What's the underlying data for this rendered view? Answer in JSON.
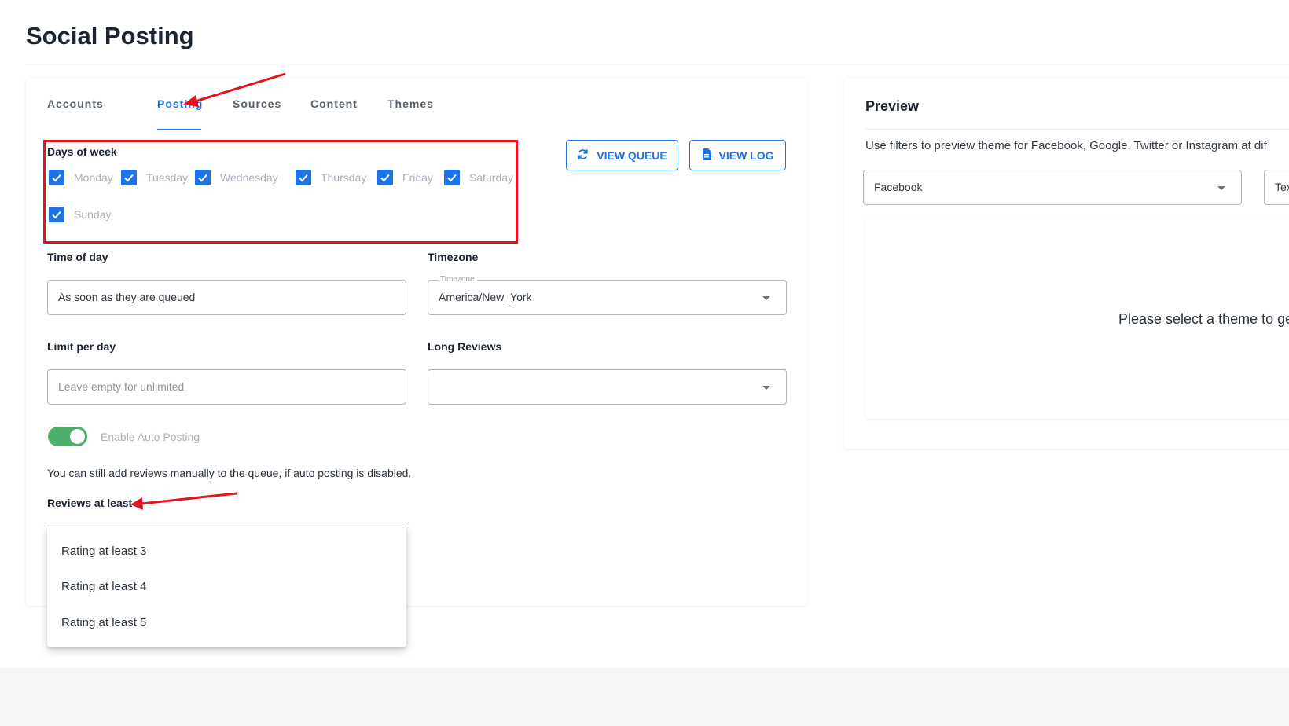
{
  "page": {
    "title": "Social Posting"
  },
  "tabs": [
    {
      "label": "Accounts",
      "active": false
    },
    {
      "label": "Posting",
      "active": true
    },
    {
      "label": "Sources",
      "active": false
    },
    {
      "label": "Content",
      "active": false
    },
    {
      "label": "Themes",
      "active": false
    }
  ],
  "posting": {
    "days_label": "Days of week",
    "days": [
      {
        "label": "Monday",
        "checked": true
      },
      {
        "label": "Tuesday",
        "checked": true
      },
      {
        "label": "Wednesday",
        "checked": true
      },
      {
        "label": "Thursday",
        "checked": true
      },
      {
        "label": "Friday",
        "checked": true
      },
      {
        "label": "Saturday",
        "checked": true
      },
      {
        "label": "Sunday",
        "checked": true
      }
    ],
    "view_queue_label": "VIEW QUEUE",
    "view_log_label": "VIEW LOG",
    "time_label": "Time of day",
    "time_value": "As soon as they are queued",
    "timezone_label": "Timezone",
    "timezone_float_label": "Timezone",
    "timezone_value": "America/New_York",
    "limit_label": "Limit per day",
    "limit_placeholder": "Leave empty for unlimited",
    "long_reviews_label": "Long Reviews",
    "long_reviews_value": "",
    "auto_posting_label": "Enable Auto Posting",
    "auto_posting_enabled": true,
    "helper_text": "You can still add reviews manually to the queue, if auto posting is disabled.",
    "reviews_at_least_label": "Reviews at least",
    "reviews_options": [
      "Rating at least 3",
      "Rating at least 4",
      "Rating at least 5"
    ]
  },
  "preview": {
    "title": "Preview",
    "description": "Use filters to preview theme for Facebook, Google, Twitter or Instagram at dif",
    "platform_value": "Facebook",
    "second_filter_value": "Tex",
    "empty_message": "Please select a theme to ge"
  },
  "colors": {
    "accent": "#1e73e8",
    "toggle_on": "#4cb06a",
    "annotation": "#e3141c"
  },
  "icons": [
    "refresh-icon",
    "file-icon",
    "check-icon",
    "chevron-down-icon"
  ]
}
